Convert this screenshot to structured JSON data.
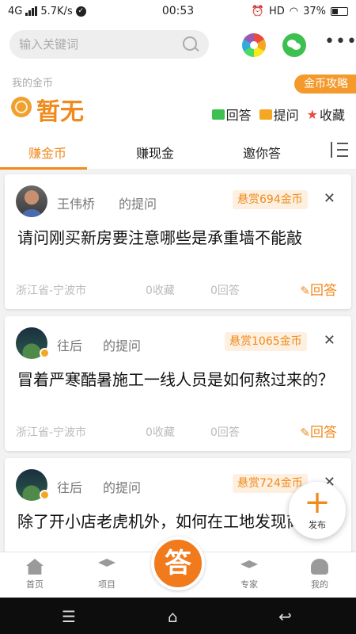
{
  "status_bar": {
    "network": "4G",
    "speed": "5.7K/s",
    "time": "00:53",
    "hd": "HD",
    "battery": "37%"
  },
  "search": {
    "placeholder": "输入关键词"
  },
  "coins": {
    "label": "我的金币",
    "value": "暂无",
    "strategy_button": "金币攻略"
  },
  "quick_links": [
    {
      "label": "回答",
      "icon": "chat-icon"
    },
    {
      "label": "提问",
      "icon": "question-icon"
    },
    {
      "label": "收藏",
      "icon": "star-icon"
    }
  ],
  "tabs": [
    {
      "label": "赚金币",
      "active": true
    },
    {
      "label": "赚现金",
      "active": false
    },
    {
      "label": "邀你答",
      "active": false
    }
  ],
  "cards": [
    {
      "author": "王伟桥",
      "asked": "的提问",
      "bounty": "悬赏694金币",
      "title": "请问刚买新房要注意哪些是承重墙不能敲",
      "location": "浙江省-宁波市",
      "favorites": "0收藏",
      "answers": "0回答",
      "answer_link": "回答"
    },
    {
      "author": "往后",
      "asked": "的提问",
      "bounty": "悬赏1065金币",
      "title": "冒着严寒酷暑施工一线人员是如何熬过来的？",
      "location": "浙江省-宁波市",
      "favorites": "0收藏",
      "answers": "0回答",
      "answer_link": "回答"
    },
    {
      "author": "往后",
      "asked": "的提问",
      "bounty": "悬赏724金币",
      "title": "除了开小店老虎机外，如何在工地发现商机？"
    }
  ],
  "fab": {
    "label": "发布"
  },
  "bottom_nav": {
    "items": [
      "首页",
      "项目",
      "专家",
      "我的"
    ],
    "center": "答"
  },
  "colors": {
    "accent": "#f08a1c",
    "green": "#3cc04f"
  }
}
